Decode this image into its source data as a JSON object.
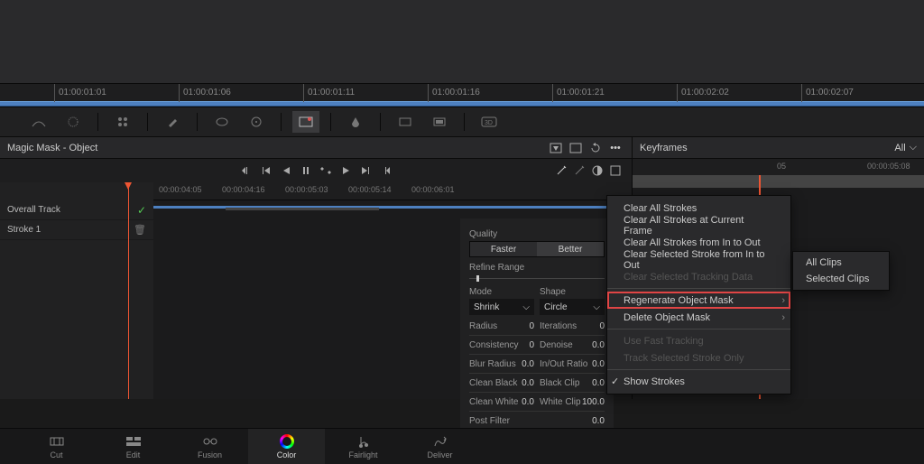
{
  "ruler_ticks": [
    "01:00:01:01",
    "01:00:01:06",
    "01:00:01:11",
    "01:00:01:16",
    "01:00:01:21",
    "01:00:02:02",
    "01:00:02:07"
  ],
  "mm": {
    "title": "Magic Mask - Object",
    "tc": [
      "00:00:04:05",
      "00:00:04:16",
      "00:00:05:03",
      "00:00:05:14",
      "00:00:06:01"
    ],
    "tracks": {
      "overall": "Overall Track",
      "stroke1": "Stroke 1"
    }
  },
  "props": {
    "quality_label": "Quality",
    "quality_faster": "Faster",
    "quality_better": "Better",
    "refine_label": "Refine Range",
    "mode_label": "Mode",
    "shape_label": "Shape",
    "mode_value": "Shrink",
    "shape_value": "Circle",
    "params": {
      "radius": {
        "label": "Radius",
        "value": "0"
      },
      "iterations": {
        "label": "Iterations",
        "value": "0"
      },
      "consistency": {
        "label": "Consistency",
        "value": "0"
      },
      "denoise": {
        "label": "Denoise",
        "value": "0.0"
      },
      "blur_radius": {
        "label": "Blur Radius",
        "value": "0.0"
      },
      "inout_ratio": {
        "label": "In/Out Ratio",
        "value": "0.0"
      },
      "clean_black": {
        "label": "Clean Black",
        "value": "0.0"
      },
      "black_clip": {
        "label": "Black Clip",
        "value": "0.0"
      },
      "clean_white": {
        "label": "Clean White",
        "value": "0.0"
      },
      "white_clip": {
        "label": "White Clip",
        "value": "100.0"
      },
      "post_filter": {
        "label": "Post Filter",
        "value": "0.0"
      }
    }
  },
  "kf": {
    "title": "Keyframes",
    "all": "All",
    "ticks": [
      "05",
      "00:00:05:08"
    ]
  },
  "menu": {
    "clear_all": "Clear All Strokes",
    "clear_current": "Clear All Strokes at Current Frame",
    "clear_in_out": "Clear All Strokes from In to Out",
    "clear_sel_in_out": "Clear Selected Stroke from In to Out",
    "clear_tracking": "Clear Selected Tracking Data",
    "regenerate": "Regenerate Object Mask",
    "delete_mask": "Delete Object Mask",
    "fast_tracking": "Use Fast Tracking",
    "track_sel": "Track Selected Stroke Only",
    "show_strokes": "Show Strokes",
    "sub_all": "All Clips",
    "sub_selected": "Selected Clips"
  },
  "pages": {
    "cut": "Cut",
    "edit": "Edit",
    "fusion": "Fusion",
    "color": "Color",
    "fairlight": "Fairlight",
    "deliver": "Deliver"
  }
}
